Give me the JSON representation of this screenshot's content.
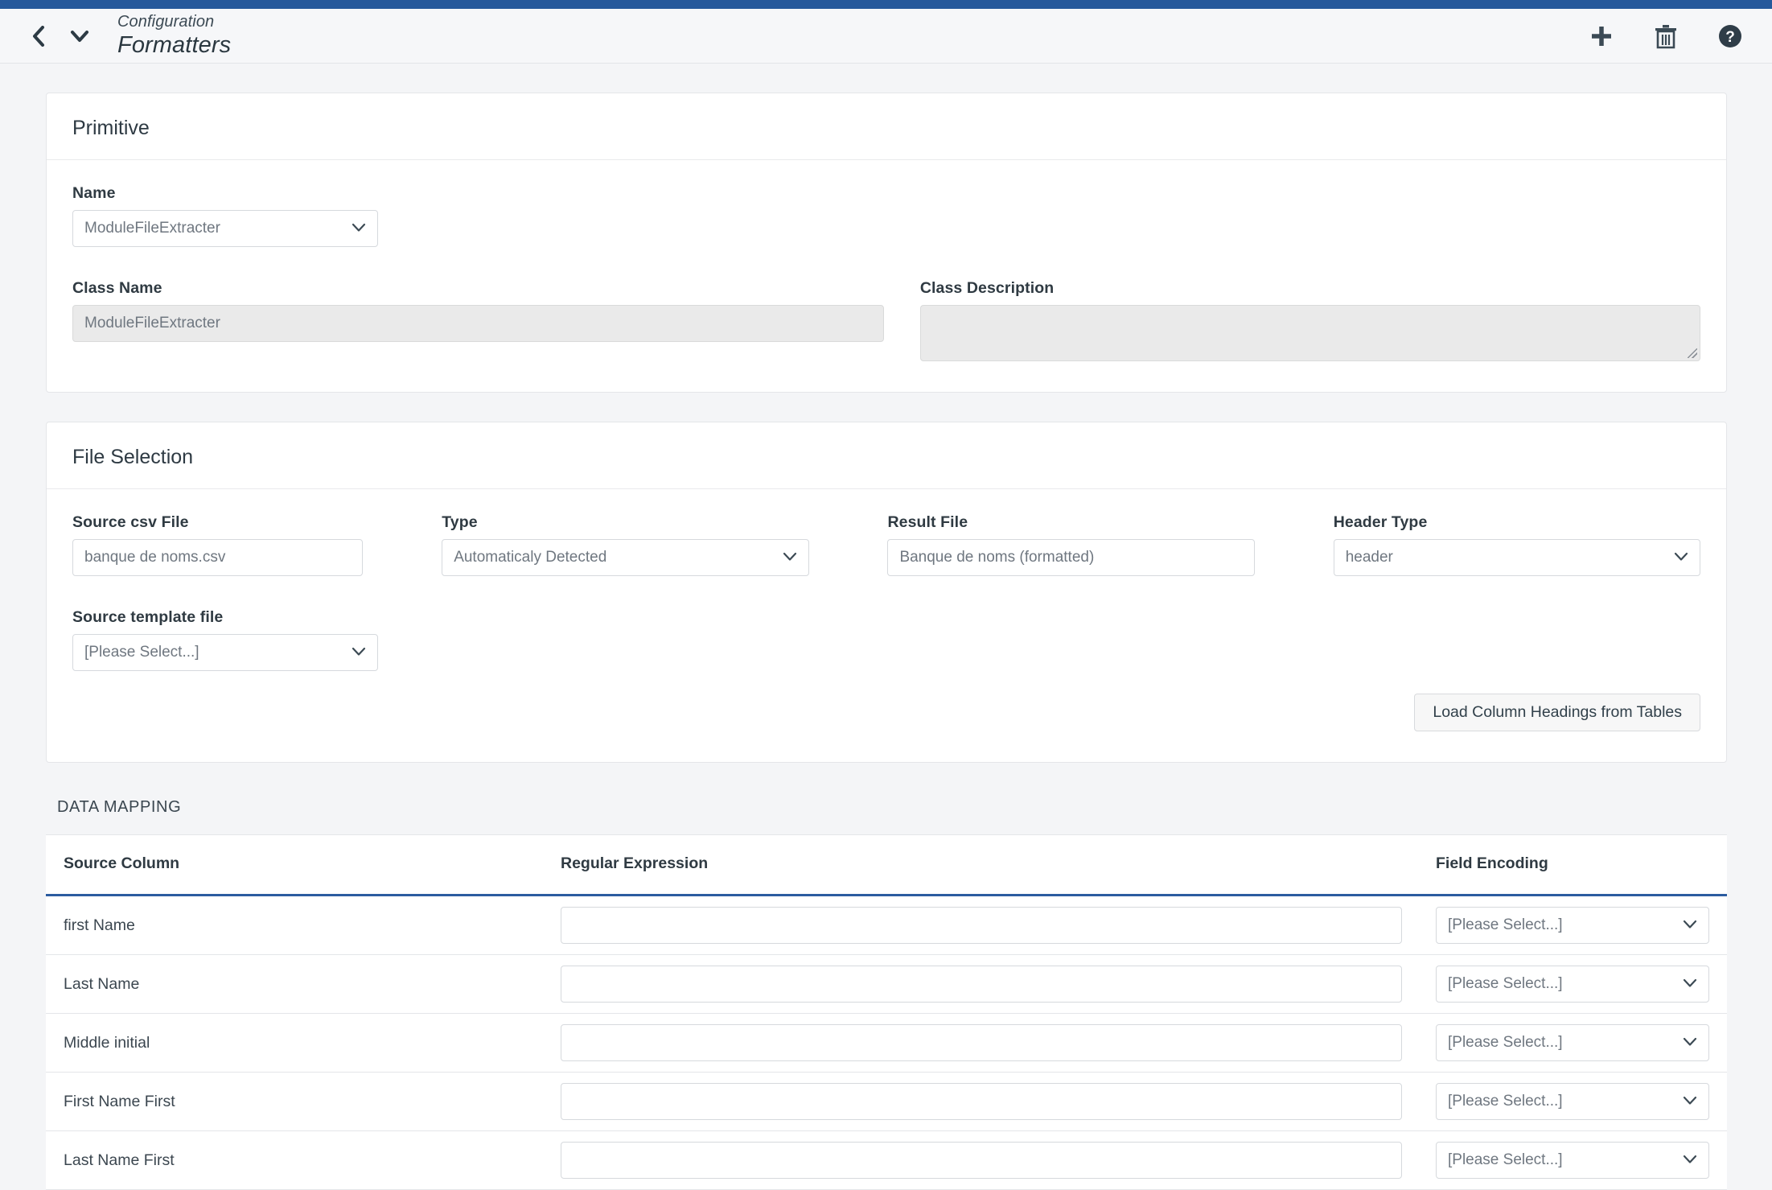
{
  "header": {
    "breadcrumb": "Configuration",
    "title": "Formatters",
    "icons": {
      "back": "chevron-left-icon",
      "dropdown": "chevron-down-icon",
      "add": "plus-icon",
      "delete": "trash-icon",
      "help": "help-circle-icon"
    }
  },
  "primitive": {
    "panel_title": "Primitive",
    "name_label": "Name",
    "name_value": "ModuleFileExtracter",
    "class_name_label": "Class Name",
    "class_name_value": "ModuleFileExtracter",
    "class_description_label": "Class Description",
    "class_description_value": ""
  },
  "file_selection": {
    "panel_title": "File Selection",
    "source_csv_label": "Source csv File",
    "source_csv_value": "banque de noms.csv",
    "type_label": "Type",
    "type_value": "Automaticaly Detected",
    "result_file_label": "Result File",
    "result_file_value": "Banque de noms (formatted)",
    "header_type_label": "Header Type",
    "header_type_value": "header",
    "source_template_label": "Source template file",
    "source_template_value": "[Please Select...]",
    "load_button": "Load Column Headings from Tables"
  },
  "data_mapping": {
    "section_title": "DATA MAPPING",
    "columns": [
      "Source Column",
      "Regular Expression",
      "Field Encoding"
    ],
    "placeholder_select": "[Please Select...]",
    "rows": [
      {
        "source_column": "first Name",
        "regex": "",
        "field_encoding": "[Please Select...]"
      },
      {
        "source_column": "Last Name",
        "regex": "",
        "field_encoding": "[Please Select...]"
      },
      {
        "source_column": "Middle initial",
        "regex": "",
        "field_encoding": "[Please Select...]"
      },
      {
        "source_column": "First Name First",
        "regex": "",
        "field_encoding": "[Please Select...]"
      },
      {
        "source_column": "Last Name First",
        "regex": "",
        "field_encoding": "[Please Select...]"
      }
    ]
  },
  "colors": {
    "accent_blue": "#26599b",
    "table_header_rule": "#2b5ca0",
    "page_background": "#f4f5f7",
    "panel_background": "#ffffff",
    "disabled_field": "#eaeaea"
  }
}
